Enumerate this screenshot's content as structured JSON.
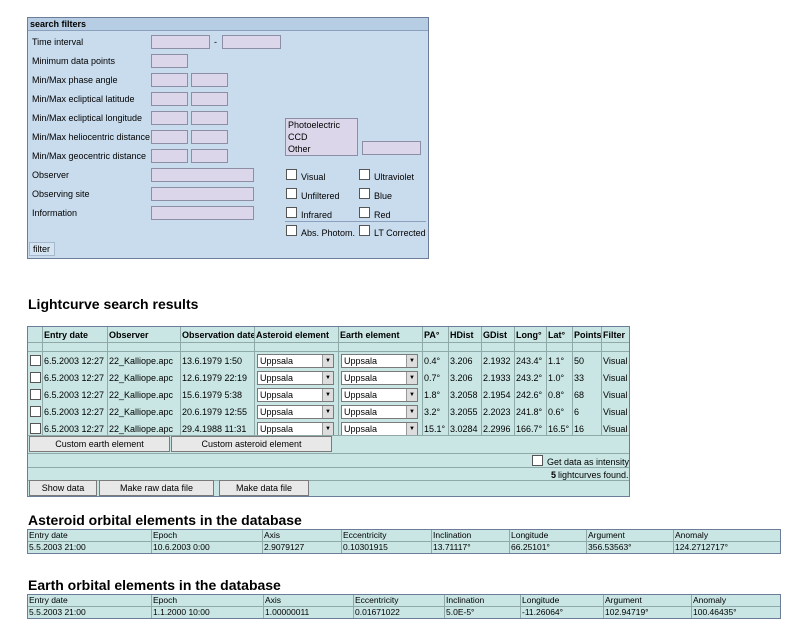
{
  "filters": {
    "title": "search filters",
    "rows": [
      {
        "label": "Time interval",
        "sep": "-"
      },
      {
        "label": "Minimum data points"
      },
      {
        "label": "Min/Max phase angle"
      },
      {
        "label": "Min/Max ecliptical latitude"
      },
      {
        "label": "Min/Max ecliptical longitude"
      },
      {
        "label": "Min/Max heliocentric distance"
      },
      {
        "label": "Min/Max geocentric distance"
      },
      {
        "label": "Observer"
      },
      {
        "label": "Observing site"
      },
      {
        "label": "Information"
      }
    ],
    "list_options": [
      "Photoelectric",
      "CCD",
      "Other"
    ],
    "checkboxes": [
      "Visual",
      "Ultraviolet",
      "Unfiltered",
      "Blue",
      "Infrared",
      "Red",
      "Abs. Photom.",
      "LT Corrected"
    ],
    "filter_label": "filter"
  },
  "results": {
    "title": "Lightcurve search results",
    "headers": [
      "Entry date",
      "Observer",
      "Observation date",
      "Asteroid element",
      "Earth element",
      "PA°",
      "HDist",
      "GDist",
      "Long°",
      "Lat°",
      "Points",
      "Filter"
    ],
    "rows": [
      [
        "6.5.2003 12:27",
        "22_Kalliope.apc",
        "13.6.1979 1:50",
        "Uppsala",
        "Uppsala",
        "0.4°",
        "3.206",
        "2.1932",
        "243.4°",
        "1.1°",
        "50",
        "Visual"
      ],
      [
        "6.5.2003 12:27",
        "22_Kalliope.apc",
        "12.6.1979 22:19",
        "Uppsala",
        "Uppsala",
        "0.7°",
        "3.206",
        "2.1933",
        "243.2°",
        "1.0°",
        "33",
        "Visual"
      ],
      [
        "6.5.2003 12:27",
        "22_Kalliope.apc",
        "15.6.1979 5:38",
        "Uppsala",
        "Uppsala",
        "1.8°",
        "3.2058",
        "2.1954",
        "242.6°",
        "0.8°",
        "68",
        "Visual"
      ],
      [
        "6.5.2003 12:27",
        "22_Kalliope.apc",
        "20.6.1979 12:55",
        "Uppsala",
        "Uppsala",
        "3.2°",
        "3.2055",
        "2.2023",
        "241.8°",
        "0.6°",
        "6",
        "Visual"
      ],
      [
        "6.5.2003 12:27",
        "22_Kalliope.apc",
        "29.4.1988 11:31",
        "Uppsala",
        "Uppsala",
        "15.1°",
        "3.0284",
        "2.2996",
        "166.7°",
        "16.5°",
        "16",
        "Visual"
      ]
    ],
    "custom_earth": "Custom earth element",
    "custom_asteroid": "Custom asteroid element",
    "intensity_label": "Get data as intensity",
    "found_count": "5",
    "found_text": "lightcurves found.",
    "show_data": "Show data",
    "make_raw": "Make raw data file",
    "make_data": "Make data file"
  },
  "asteroid": {
    "title": "Asteroid orbital elements in the database",
    "headers": [
      "Entry date",
      "Epoch",
      "Axis",
      "Eccentricity",
      "Inclination",
      "Longitude",
      "Argument",
      "Anomaly"
    ],
    "values": [
      "5.5.2003 21:00",
      "10.6.2003 0:00",
      "2.9079127",
      "0.10301915",
      "13.71117°",
      "66.25101°",
      "356.53563°",
      "124.2712717°"
    ]
  },
  "earth": {
    "title": "Earth orbital elements in the database",
    "headers": [
      "Entry date",
      "Epoch",
      "Axis",
      "Eccentricity",
      "Inclination",
      "Longitude",
      "Argument",
      "Anomaly"
    ],
    "values": [
      "5.5.2003 21:00",
      "1.1.2000 10:00",
      "1.00000011",
      "0.01671022",
      "5.0E-5°",
      "-11.26064°",
      "102.94719°",
      "100.46435°"
    ]
  },
  "colors": {
    "panel": "#c9dced",
    "table": "#c9e6e4",
    "border": "#6b7d99"
  }
}
